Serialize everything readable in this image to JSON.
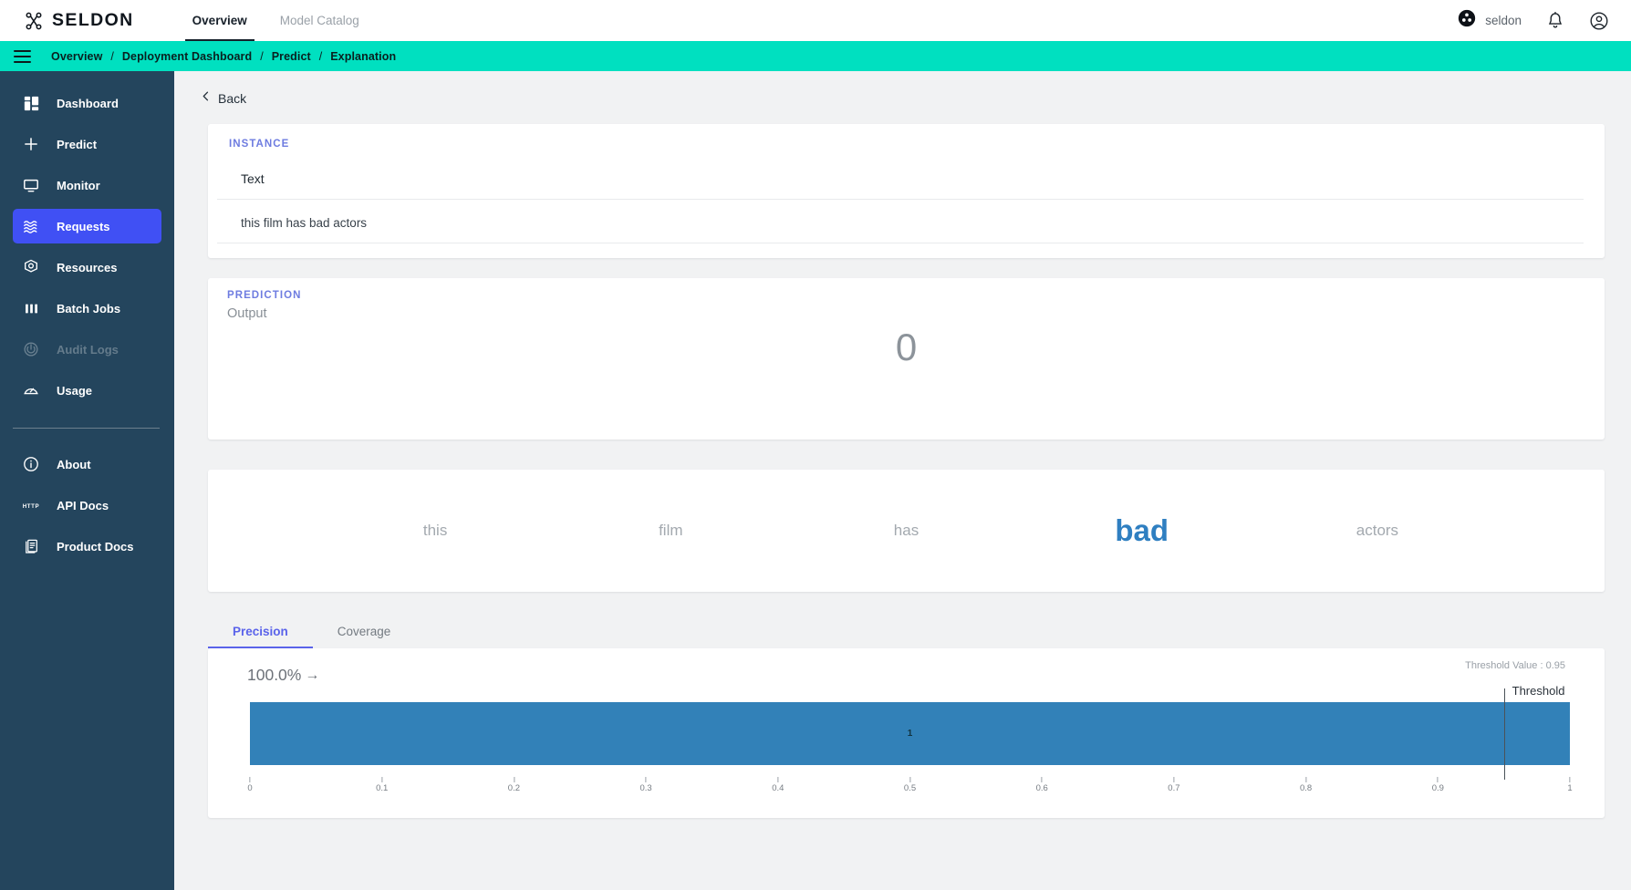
{
  "topbar": {
    "brand": "SELDON",
    "brand_icon": "seldon-logo-icon",
    "tabs": [
      {
        "label": "Overview",
        "active": true
      },
      {
        "label": "Model Catalog",
        "active": false
      }
    ],
    "org_icon": "seldon-org-icon",
    "org_name": "seldon",
    "notifications_icon": "bell-icon",
    "account_icon": "account-circle-icon"
  },
  "breadcrumbbar": {
    "menu_icon": "hamburger-menu-icon",
    "separator": "/",
    "crumbs": [
      "Overview",
      "Deployment Dashboard",
      "Predict",
      "Explanation"
    ],
    "background": "#00e0c0"
  },
  "sidebar": {
    "background": "#24455d",
    "active_color": "#4050f4",
    "items": [
      {
        "label": "Dashboard",
        "icon": "dashboard-grid-icon",
        "active": false,
        "dim": false
      },
      {
        "label": "Predict",
        "icon": "plus-icon",
        "active": false,
        "dim": false
      },
      {
        "label": "Monitor",
        "icon": "monitor-screen-icon",
        "active": false,
        "dim": false
      },
      {
        "label": "Requests",
        "icon": "waves-icon",
        "active": true,
        "dim": false
      },
      {
        "label": "Resources",
        "icon": "kubernetes-icon",
        "active": false,
        "dim": false
      },
      {
        "label": "Batch Jobs",
        "icon": "bars-icon",
        "active": false,
        "dim": false
      },
      {
        "label": "Audit Logs",
        "icon": "power-log-icon",
        "active": false,
        "dim": true
      },
      {
        "label": "Usage",
        "icon": "gauge-icon",
        "active": false,
        "dim": false
      }
    ],
    "footer_items": [
      {
        "label": "About",
        "icon": "info-circle-icon"
      },
      {
        "label": "API Docs",
        "icon": "http-icon"
      },
      {
        "label": "Product Docs",
        "icon": "book-stack-icon"
      }
    ]
  },
  "main": {
    "back": {
      "label": "Back",
      "icon": "chevron-left-icon"
    },
    "instance": {
      "kicker": "INSTANCE",
      "column_header": "Text",
      "value": "this film has bad actors"
    },
    "prediction": {
      "kicker": "PREDICTION",
      "output_label": "Output",
      "value": "0"
    },
    "anchor": {
      "words": [
        {
          "text": "this",
          "highlighted": false
        },
        {
          "text": "film",
          "highlighted": false
        },
        {
          "text": "has",
          "highlighted": false
        },
        {
          "text": "bad",
          "highlighted": true
        },
        {
          "text": "actors",
          "highlighted": false
        }
      ],
      "highlight_color": "#2f7fc1"
    },
    "tabs": [
      {
        "label": "Precision",
        "active": true
      },
      {
        "label": "Coverage",
        "active": false
      }
    ]
  },
  "chart_data": {
    "type": "bar",
    "title": "",
    "orientation": "horizontal",
    "percent_label": "100.0%",
    "percent_arrow": "→",
    "threshold_caption": "Threshold Value : 0.95",
    "threshold_label": "Threshold",
    "threshold": 0.95,
    "categories": [
      "1"
    ],
    "values": [
      1
    ],
    "bar_labels": [
      "1"
    ],
    "bar_color": "#3281b8",
    "xlabel": "",
    "ylabel": "",
    "xlim": [
      0,
      1
    ],
    "grid": false,
    "legend": "none",
    "tick_labels": [
      "0",
      "0.1",
      "0.2",
      "0.3",
      "0.4",
      "0.5",
      "0.6",
      "0.7",
      "0.8",
      "0.9",
      "1"
    ],
    "tick_values": [
      0,
      0.1,
      0.2,
      0.3,
      0.4,
      0.5,
      0.6,
      0.7,
      0.8,
      0.9,
      1
    ]
  }
}
